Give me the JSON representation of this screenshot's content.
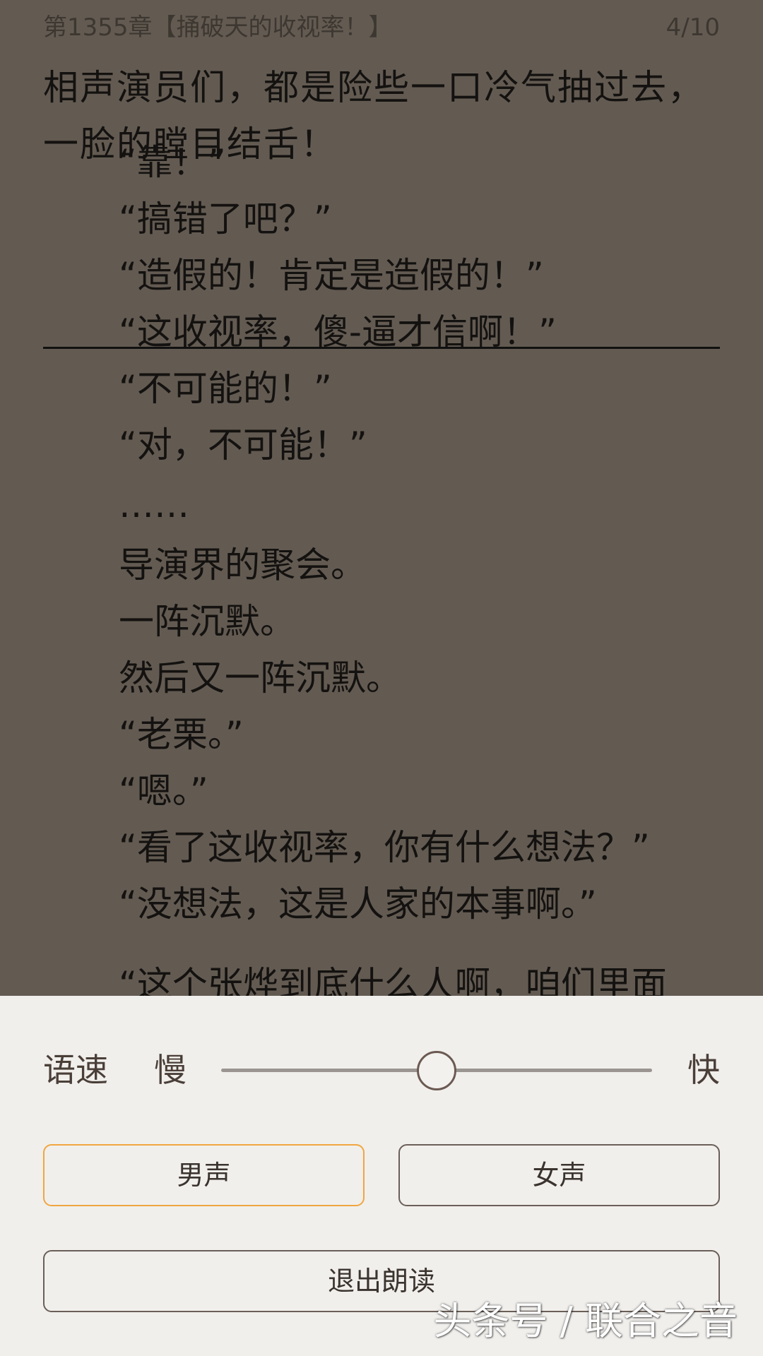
{
  "header": {
    "chapter_title": "第1355章【捅破天的收视率！】",
    "page_indicator": "4/10"
  },
  "content": {
    "paragraphs": [
      "相声演员们，都是险些一口冷气抽过去，一脸的瞠目结舌！",
      "“靠！”",
      "“搞错了吧？”",
      "“造假的！肯定是造假的！”",
      "“这收视率，傻-逼才信啊！”",
      "“不可能的！”",
      "“对，不可能！”",
      "……",
      "导演界的聚会。",
      "一阵沉默。",
      "然后又一阵沉默。",
      "“老栗。”",
      "“嗯。”",
      "“看了这收视率，你有什么想法？”",
      "“没想法，这是人家的本事啊。”",
      "“这个张烨到底什么人啊，咱们里面"
    ]
  },
  "tts_panel": {
    "speed_label": "语速",
    "slow_label": "慢",
    "fast_label": "快",
    "speed_value": 0.5,
    "male_voice_label": "男声",
    "female_voice_label": "女声",
    "selected_voice": "男声",
    "exit_label": "退出朗读"
  },
  "watermark": "头条号 / 联合之音",
  "colors": {
    "reader_background": "#635b52",
    "panel_background": "#f1efec",
    "selected_accent": "#f0a640"
  }
}
